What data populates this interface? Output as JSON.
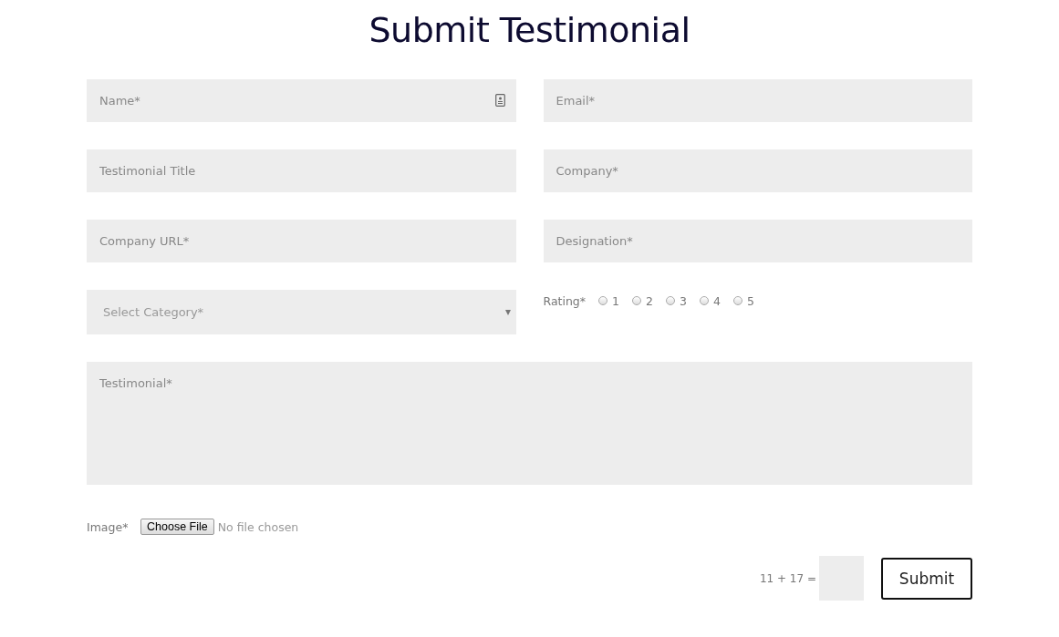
{
  "title": "Submit Testimonial",
  "fields": [
    {
      "kind": "input",
      "placeholder": "Name*",
      "contact_icon": true
    },
    {
      "kind": "input",
      "placeholder": "Email*"
    },
    {
      "kind": "input",
      "placeholder": "Testimonial Title"
    },
    {
      "kind": "input",
      "placeholder": "Company*"
    },
    {
      "kind": "input",
      "placeholder": "Company URL*"
    },
    {
      "kind": "input",
      "placeholder": "Designation*"
    },
    {
      "kind": "select",
      "placeholder": "Select Category*"
    },
    {
      "kind": "rating",
      "label": "Rating*",
      "options": [
        {
          "label": "1",
          "selected": false
        },
        {
          "label": "2",
          "selected": false
        },
        {
          "label": "3",
          "selected": false
        },
        {
          "label": "4",
          "selected": false
        },
        {
          "label": "5",
          "selected": false
        }
      ]
    }
  ],
  "testimonial": {
    "placeholder": "Testimonial*"
  },
  "image": {
    "label": "Image*",
    "button": "Choose File",
    "status": "No file chosen"
  },
  "captcha": {
    "question": "11 + 17 ="
  },
  "submit": "Submit"
}
